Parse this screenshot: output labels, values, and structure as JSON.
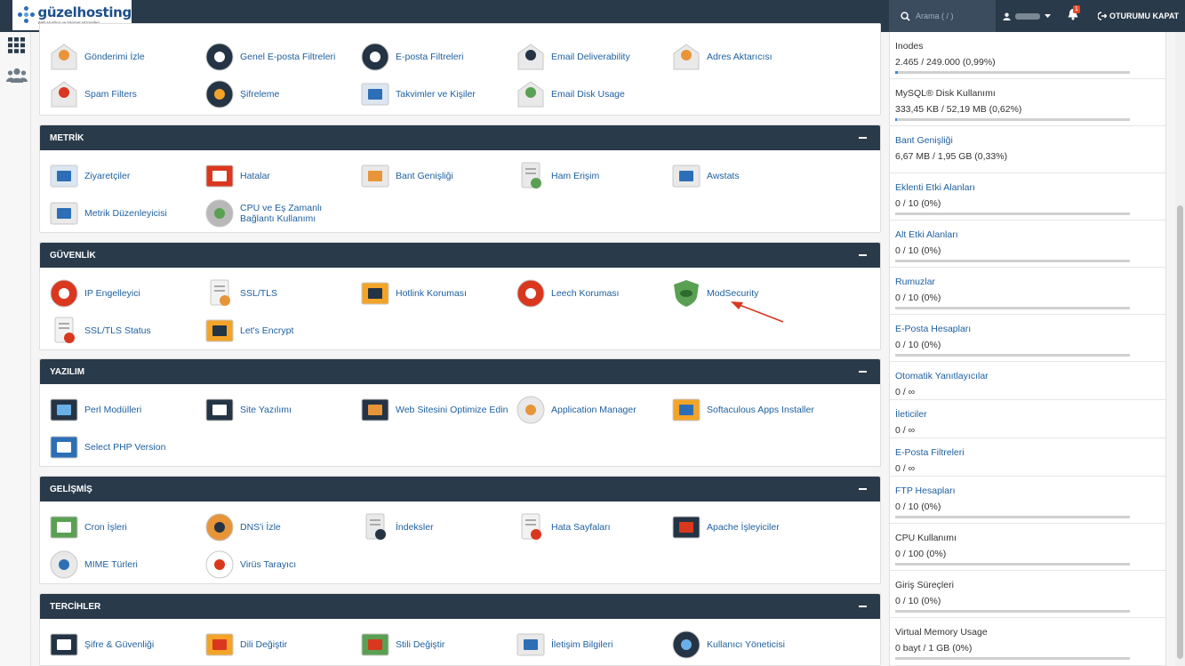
{
  "header": {
    "brand": "güzelhosting",
    "tagline": "Web Hosting ve İnternet Hizmetleri",
    "search_placeholder": "Arama ( / )",
    "notification_count": "1",
    "logout_label": "OTURUMU KAPAT"
  },
  "sections": {
    "email": {
      "rows": [
        [
          {
            "label": "Gönderimi İzle",
            "icon": "track-delivery-icon"
          },
          {
            "label": "Genel E-posta Filtreleri",
            "icon": "global-filter-icon"
          },
          {
            "label": "E-posta Filtreleri",
            "icon": "email-filter-icon"
          },
          {
            "label": "Email Deliverability",
            "icon": "deliverability-icon"
          },
          {
            "label": "Adres Aktarıcısı",
            "icon": "address-importer-icon"
          }
        ],
        [
          {
            "label": "Spam Filters",
            "icon": "spam-filters-icon"
          },
          {
            "label": "Şifreleme",
            "icon": "encryption-icon"
          },
          {
            "label": "Takvimler ve Kişiler",
            "icon": "calendar-contacts-icon"
          },
          {
            "label": "Email Disk Usage",
            "icon": "email-disk-usage-icon"
          }
        ]
      ]
    },
    "metrics": {
      "title": "METRİK",
      "rows": [
        [
          {
            "label": "Ziyaretçiler",
            "icon": "visitors-icon"
          },
          {
            "label": "Hatalar",
            "icon": "errors-icon"
          },
          {
            "label": "Bant Genişliği",
            "icon": "bandwidth-icon"
          },
          {
            "label": "Ham Erişim",
            "icon": "raw-access-icon"
          },
          {
            "label": "Awstats",
            "icon": "awstats-icon"
          }
        ],
        [
          {
            "label": "Metrik Düzenleyicisi",
            "icon": "metrics-editor-icon"
          },
          {
            "label": "CPU ve Eş Zamanlı Bağlantı Kullanımı",
            "icon": "cpu-usage-icon"
          }
        ]
      ]
    },
    "security": {
      "title": "GÜVENLİK",
      "rows": [
        [
          {
            "label": "IP Engelleyici",
            "icon": "ip-blocker-icon"
          },
          {
            "label": "SSL/TLS",
            "icon": "ssl-tls-icon"
          },
          {
            "label": "Hotlink Koruması",
            "icon": "hotlink-protection-icon"
          },
          {
            "label": "Leech Koruması",
            "icon": "leech-protection-icon"
          },
          {
            "label": "ModSecurity",
            "icon": "modsecurity-icon"
          }
        ],
        [
          {
            "label": "SSL/TLS Status",
            "icon": "ssl-status-icon"
          },
          {
            "label": "Let's Encrypt",
            "icon": "lets-encrypt-icon"
          }
        ]
      ]
    },
    "software": {
      "title": "YAZILIM",
      "rows": [
        [
          {
            "label": "Perl Modülleri",
            "icon": "perl-modules-icon"
          },
          {
            "label": "Site Yazılımı",
            "icon": "site-software-icon"
          },
          {
            "label": "Web Sitesini Optimize Edin",
            "icon": "optimize-website-icon"
          },
          {
            "label": "Application Manager",
            "icon": "application-manager-icon"
          },
          {
            "label": "Softaculous Apps Installer",
            "icon": "softaculous-icon"
          }
        ],
        [
          {
            "label": "Select PHP Version",
            "icon": "php-version-icon"
          }
        ]
      ]
    },
    "advanced": {
      "title": "GELİŞMİŞ",
      "rows": [
        [
          {
            "label": "Cron İşleri",
            "icon": "cron-jobs-icon"
          },
          {
            "label": "DNS'i İzle",
            "icon": "track-dns-icon"
          },
          {
            "label": "İndeksler",
            "icon": "indexes-icon"
          },
          {
            "label": "Hata Sayfaları",
            "icon": "error-pages-icon"
          },
          {
            "label": "Apache İşleyiciler",
            "icon": "apache-handlers-icon"
          }
        ],
        [
          {
            "label": "MIME Türleri",
            "icon": "mime-types-icon"
          },
          {
            "label": "Virüs Tarayıcı",
            "icon": "virus-scanner-icon"
          }
        ]
      ]
    },
    "preferences": {
      "title": "TERCİHLER",
      "rows": [
        [
          {
            "label": "Şifre & Güvenliği",
            "icon": "password-security-icon"
          },
          {
            "label": "Dili Değiştir",
            "icon": "change-language-icon"
          },
          {
            "label": "Stili Değiştir",
            "icon": "change-style-icon"
          },
          {
            "label": "İletişim Bilgileri",
            "icon": "contact-info-icon"
          },
          {
            "label": "Kullanıcı Yöneticisi",
            "icon": "user-manager-icon"
          }
        ]
      ]
    }
  },
  "stats": [
    {
      "label": "Inodes",
      "value": "2.465 / 249.000  (0,99%)",
      "link": false,
      "bar": true,
      "percent": 0.99
    },
    {
      "label": "MySQL® Disk Kullanımı",
      "value": "333,45 KB / 52,19 MB  (0,62%)",
      "link": false,
      "bar": true,
      "percent": 0.62
    },
    {
      "label": "Bant Genişliği",
      "value": "6,67 MB / 1,95 GB  (0,33%)",
      "link": true,
      "bar": false,
      "percent": 0.33
    },
    {
      "label": "Eklenti Etki Alanları",
      "value": "0 / 10  (0%)",
      "link": true,
      "bar": true,
      "percent": 0
    },
    {
      "label": "Alt Etki Alanları",
      "value": "0 / 10  (0%)",
      "link": true,
      "bar": true,
      "percent": 0
    },
    {
      "label": "Rumuzlar",
      "value": "0 / 10  (0%)",
      "link": true,
      "bar": true,
      "percent": 0
    },
    {
      "label": "E-Posta Hesapları",
      "value": "0 / 10  (0%)",
      "link": true,
      "bar": true,
      "percent": 0
    },
    {
      "label": "Otomatik Yanıtlayıcılar",
      "value": "0 / ∞",
      "link": true,
      "bar": false,
      "percent": 0
    },
    {
      "label": "İleticiler",
      "value": "0 / ∞",
      "link": true,
      "bar": false,
      "percent": 0
    },
    {
      "label": "E-Posta Filtreleri",
      "value": "0 / ∞",
      "link": true,
      "bar": false,
      "percent": 0
    },
    {
      "label": "FTP Hesapları",
      "value": "0 / 10  (0%)",
      "link": true,
      "bar": true,
      "percent": 0
    },
    {
      "label": "CPU Kullanımı",
      "value": "0 / 100  (0%)",
      "link": false,
      "bar": true,
      "percent": 0
    },
    {
      "label": "Giriş Süreçleri",
      "value": "0 / 10  (0%)",
      "link": false,
      "bar": true,
      "percent": 0
    },
    {
      "label": "Virtual Memory Usage",
      "value": "0 bayt / 1 GB  (0%)",
      "link": false,
      "bar": true,
      "percent": 0
    }
  ],
  "colors": {
    "header": "#293a4a",
    "link": "#1d5f9f",
    "bar_track": "#d0d0d0",
    "annotation_arrow": "#d9381e"
  }
}
